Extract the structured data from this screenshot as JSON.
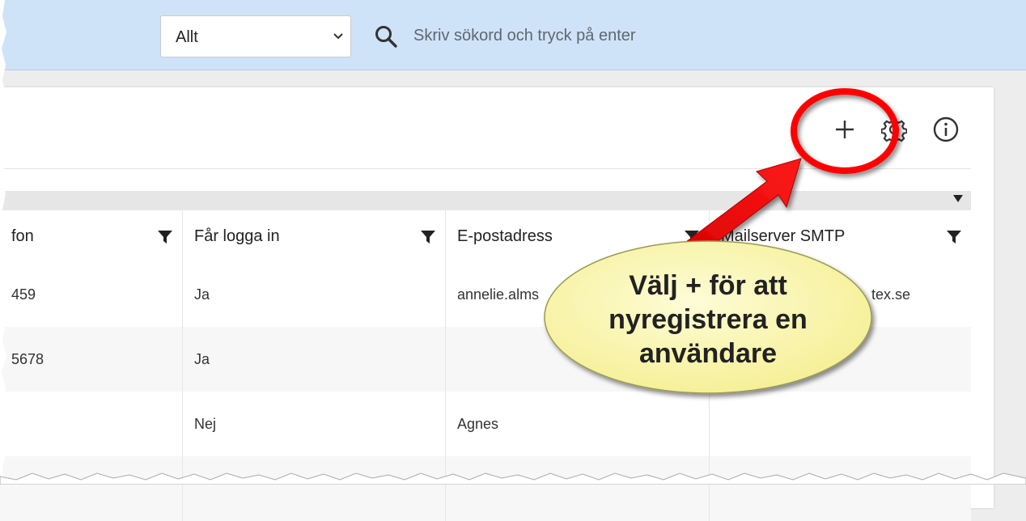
{
  "topbar": {
    "category_select": {
      "value": "Allt"
    },
    "search": {
      "placeholder": "Skriv sökord och tryck på enter"
    }
  },
  "toolbar": {
    "add_icon": "plus-icon",
    "settings_icon": "gear-icon",
    "info_icon": "info-icon"
  },
  "table": {
    "columns": [
      "fon",
      "Får logga in",
      "E-postadress",
      "Mailserver SMTP"
    ],
    "rows": [
      [
        "459",
        "Ja",
        "annelie.alms",
        "tex.se"
      ],
      [
        "5678",
        "Ja",
        "",
        ""
      ],
      [
        "",
        "Nej",
        "Agnes",
        ""
      ],
      [
        "",
        "",
        "",
        ""
      ]
    ]
  },
  "annotation": {
    "callout_text": "Välj + för att nyregistrera en användare",
    "colors": {
      "circle": "#ff0000",
      "bubble": "#fbf7a8",
      "accent_bar": "#cfe3f8"
    }
  }
}
